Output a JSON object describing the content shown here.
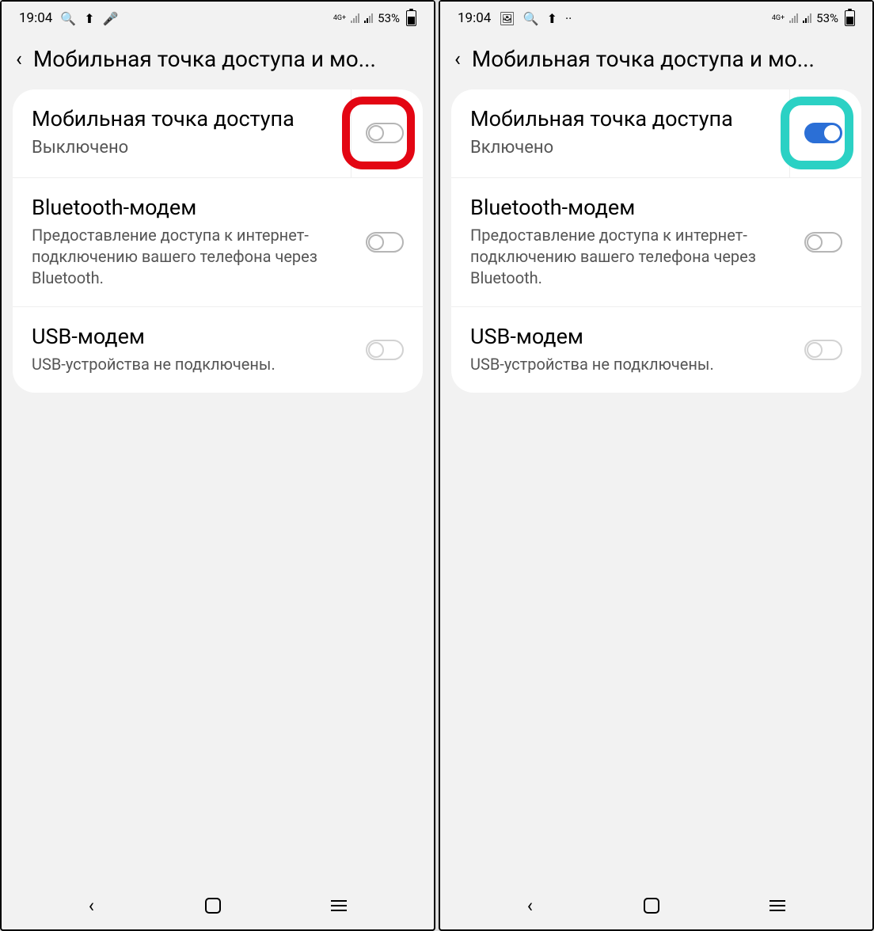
{
  "screens": [
    {
      "statusbar": {
        "time": "19:04",
        "net_label": "4G+",
        "battery_pct": "53%"
      },
      "header": {
        "title": "Мобильная точка доступа и мо..."
      },
      "rows": [
        {
          "title": "Мобильная точка доступа",
          "sub": "Выключено",
          "on": false,
          "highlight": "red"
        },
        {
          "title": "Bluetooth-модем",
          "sub": "Предоставление доступа к интернет-подключению вашего телефона через Bluetooth.",
          "on": false
        },
        {
          "title": "USB-модем",
          "sub": "USB-устройства не подключены.",
          "on": false,
          "disabled": true
        }
      ]
    },
    {
      "statusbar": {
        "time": "19:04",
        "net_label": "4G+",
        "battery_pct": "53%"
      },
      "header": {
        "title": "Мобильная точка доступа и мо..."
      },
      "rows": [
        {
          "title": "Мобильная точка доступа",
          "sub": "Включено",
          "on": true,
          "highlight": "teal"
        },
        {
          "title": "Bluetooth-модем",
          "sub": "Предоставление доступа к интернет-подключению вашего телефона через Bluetooth.",
          "on": false
        },
        {
          "title": "USB-модем",
          "sub": "USB-устройства не подключены.",
          "on": false,
          "disabled": true
        }
      ]
    }
  ]
}
